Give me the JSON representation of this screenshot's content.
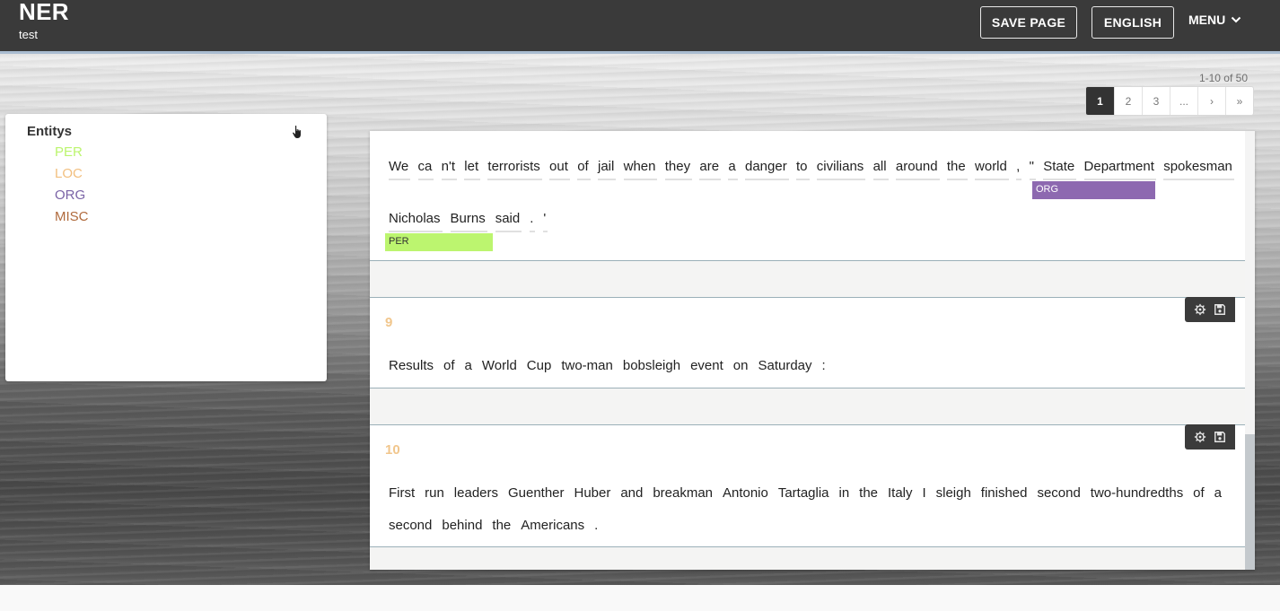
{
  "app": {
    "title": "NER",
    "subtitle": "test"
  },
  "header": {
    "save_label": "SAVE PAGE",
    "language_label": "ENGLISH",
    "menu_label": "MENU"
  },
  "pagination": {
    "range_text": "1-10 of 50",
    "pages": [
      "1",
      "2",
      "3",
      "...",
      "›",
      "»"
    ],
    "active": "1"
  },
  "entities": {
    "title": "Entitys",
    "items": [
      {
        "label": "PER",
        "color": "#bcf56f"
      },
      {
        "label": "LOC",
        "color": "#f2bf7e"
      },
      {
        "label": "ORG",
        "color": "#7a63a6"
      },
      {
        "label": "MISC",
        "color": "#b06a3c"
      }
    ]
  },
  "sentences": [
    {
      "number": "",
      "line1": [
        "We",
        "ca",
        "n't",
        "let",
        "terrorists",
        "out",
        "of",
        "jail",
        "when",
        "they",
        "are",
        "a",
        "danger",
        "to",
        "civilians",
        "all",
        "around",
        "the",
        "world",
        ",",
        "\"",
        "State",
        "Department",
        "spokesman"
      ],
      "line2": [
        "Nicholas",
        "Burns",
        "said",
        ".",
        "'"
      ],
      "annotations": [
        {
          "label": "ORG",
          "color": "#8d69b0",
          "text": "State Department"
        },
        {
          "label": "PER",
          "color": "#bcf56f",
          "text": "Nicholas Burns"
        }
      ]
    },
    {
      "number": "9",
      "line1": [
        "Results",
        "of",
        "a",
        "World",
        "Cup",
        "two-man",
        "bobsleigh",
        "event",
        "on",
        "Saturday",
        ":"
      ]
    },
    {
      "number": "10",
      "line1": [
        "First",
        "run",
        "leaders",
        "Guenther",
        "Huber",
        "and",
        "breakman",
        "Antonio",
        "Tartaglia",
        "in",
        "the",
        "Italy",
        "I",
        "sleigh",
        "finished",
        "second",
        "two-hundredths",
        "of",
        "a"
      ],
      "line2": [
        "second",
        "behind",
        "the",
        "Americans",
        "."
      ]
    }
  ],
  "icons": {
    "menu": "chevron-down-icon",
    "entity_cursor": "hand-pointer-icon",
    "row_reset": "gear-reset-icon",
    "row_save": "floppy-save-icon"
  }
}
